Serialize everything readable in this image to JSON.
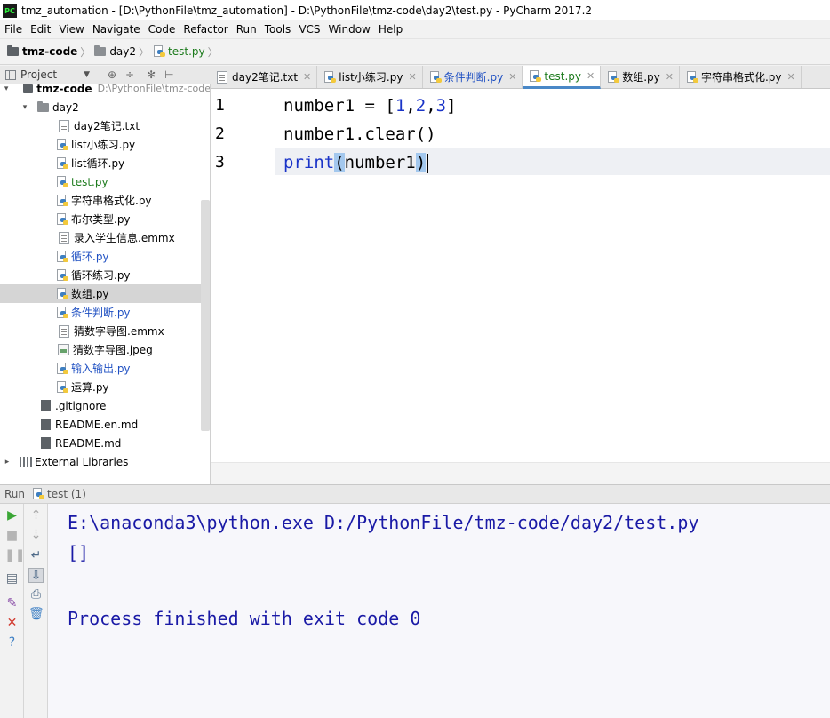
{
  "window": {
    "icon_text": "PC",
    "title": "tmz_automation - [D:\\PythonFile\\tmz_automation] - D:\\PythonFile\\tmz-code\\day2\\test.py - PyCharm 2017.2"
  },
  "menu": [
    "File",
    "Edit",
    "View",
    "Navigate",
    "Code",
    "Refactor",
    "Run",
    "Tools",
    "VCS",
    "Window",
    "Help"
  ],
  "breadcrumb": [
    "tmz-code",
    "day2",
    "test.py"
  ],
  "project_panel": {
    "label": "Project",
    "tools": [
      "⊕",
      "÷",
      "✻",
      "⊢"
    ]
  },
  "tree": {
    "root": {
      "label": "tmz-code",
      "path": "D:\\PythonFile\\tmz-code"
    },
    "folder": "day2",
    "files": [
      {
        "label": "day2笔记.txt",
        "icon": "text-file-icon"
      },
      {
        "label": "list小练习.py",
        "icon": "python-file-icon"
      },
      {
        "label": "list循环.py",
        "icon": "python-file-icon"
      },
      {
        "label": "test.py",
        "icon": "python-file-icon"
      },
      {
        "label": "字符串格式化.py",
        "icon": "python-file-icon"
      },
      {
        "label": "布尔类型.py",
        "icon": "python-file-icon"
      },
      {
        "label": "录入学生信息.emmx",
        "icon": "text-file-icon"
      },
      {
        "label": "循环.py",
        "icon": "python-file-icon"
      },
      {
        "label": "循环练习.py",
        "icon": "python-file-icon"
      },
      {
        "label": "数组.py",
        "icon": "python-file-icon"
      },
      {
        "label": "条件判断.py",
        "icon": "python-file-icon"
      },
      {
        "label": "猜数字导图.emmx",
        "icon": "text-file-icon"
      },
      {
        "label": "猜数字导图.jpeg",
        "icon": "image-file-icon"
      },
      {
        "label": "输入输出.py",
        "icon": "python-file-icon"
      },
      {
        "label": "运算.py",
        "icon": "python-file-icon"
      }
    ],
    "root_files": [
      ".gitignore",
      "README.en.md",
      "README.md"
    ],
    "external": "External Libraries"
  },
  "tabs": [
    {
      "label": "day2笔记.txt",
      "active": false
    },
    {
      "label": "list小练习.py",
      "active": false
    },
    {
      "label": "条件判断.py",
      "active": false
    },
    {
      "label": "test.py",
      "active": true
    },
    {
      "label": "数组.py",
      "active": false
    },
    {
      "label": "字符串格式化.py",
      "active": false
    }
  ],
  "editor": {
    "line_numbers": [
      "1",
      "2",
      "3"
    ],
    "line1": {
      "name": "number1",
      "op": " = ",
      "open": "[",
      "n1": "1",
      "c1": ",",
      "n2": "2",
      "c2": ",",
      "n3": "3",
      "close": "]"
    },
    "line2": "number1.clear()",
    "line3": {
      "fn": "print",
      "open": "(",
      "arg": "number1",
      "close": ")"
    }
  },
  "run": {
    "label": "Run",
    "tab": "test (1)",
    "output": [
      "E:\\anaconda3\\python.exe D:/PythonFile/tmz-code/day2/test.py",
      "[]",
      "",
      "Process finished with exit code 0"
    ]
  },
  "colors": {
    "accent": "#4a88c7",
    "keyword_blue": "#1a34c8",
    "console_text": "#1a1aa6",
    "vcs_green": "#1d7b1d",
    "vcs_blue": "#1e4fc2"
  }
}
